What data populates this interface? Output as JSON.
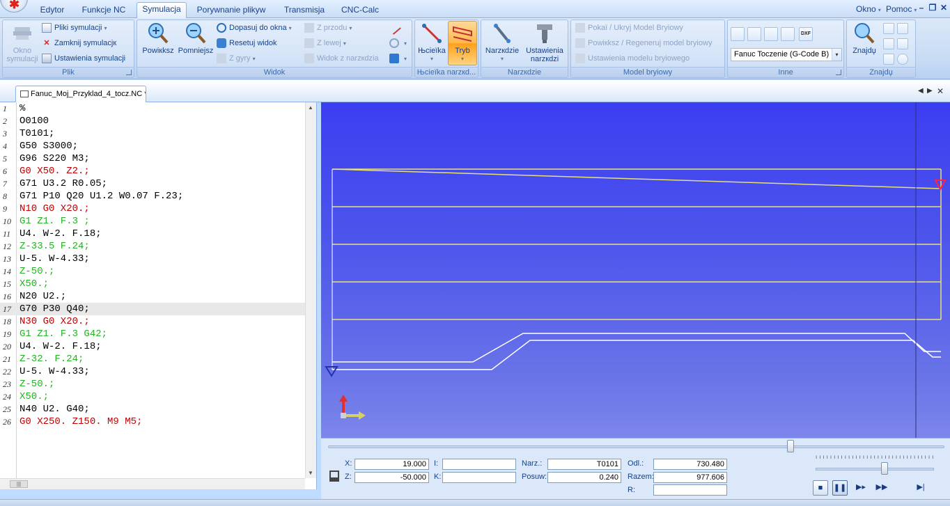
{
  "tabs": [
    {
      "label": "Edytor"
    },
    {
      "label": "Funkcje NC"
    },
    {
      "label": "Symulacja"
    },
    {
      "label": "Porywnanie plikyw"
    },
    {
      "label": "Transmisja"
    },
    {
      "label": "CNC-Calc"
    }
  ],
  "top_right": {
    "okno": "Okno",
    "pomoc": "Pomoc"
  },
  "ribbon": {
    "plik": {
      "label": "Plik",
      "okno_symulacji": "Okno symulacji",
      "pliki_symulacji": "Pliki symulacji",
      "zamknij_symulacje": "Zamknij symulacjк",
      "ustawienia_symulacji": "Ustawienia symulacji"
    },
    "widok": {
      "label": "Widok",
      "powieksz": "Powiкksz",
      "pomniejsz": "Pomniejsz",
      "dopasuj": "Dopasuj do okna",
      "resetuj": "Resetuj widok",
      "z_gory": "Z gуry",
      "z_przodu": "Z przodu",
      "z_lewej": "Z lewej",
      "widok_z_narzedzia": "Widok z narzкdzia"
    },
    "sciezka": {
      "label": "Њcieїka narzкd...",
      "sciezka_btn": "Њcieїka",
      "tryb_btn": "Tryb"
    },
    "narzedzie": {
      "label": "Narzкdzie",
      "narzedzie_btn": "Narzкdzie",
      "ustawienia_narzedzi": "Ustawienia narzкdzi"
    },
    "model": {
      "label": "Model bryіowy",
      "pokaz_ukryj": "Pokaї / Ukryj Model Bryіowy",
      "powieksz_regeneruj": "Powiкksz / Regeneruj model bryіowy",
      "ustawienia_modelu": "Ustawienia modelu bryіowego"
    },
    "inne": {
      "label": "Inne",
      "machine_select": "Fanuc Toczenie (G-Code B)"
    },
    "znajdz": {
      "label": "Znajdџ",
      "znajdz_btn": "Znajdџ"
    }
  },
  "document_tab": "Fanuc_Moj_Przyklad_4_tocz.NC *",
  "code_lines": [
    {
      "n": "1",
      "text": "%",
      "color": "black"
    },
    {
      "n": "2",
      "text": "O0100",
      "color": "black"
    },
    {
      "n": "3",
      "text": "T0101;",
      "color": "black"
    },
    {
      "n": "4",
      "text": "G50 S3000;",
      "color": "black"
    },
    {
      "n": "5",
      "text": "G96 S220 M3;",
      "color": "black"
    },
    {
      "n": "6",
      "text": "G0 X50. Z2.;",
      "color": "red"
    },
    {
      "n": "7",
      "text": "G71 U3.2 R0.05;",
      "color": "black"
    },
    {
      "n": "8",
      "text": "G71 P10 Q20 U1.2 W0.07 F.23;",
      "color": "black"
    },
    {
      "n": "9",
      "text": "N10 G0 X20.;",
      "color": "red"
    },
    {
      "n": "10",
      "text": "G1 Z1. F.3 ;",
      "color": "green"
    },
    {
      "n": "11",
      "text": "U4. W-2. F.18;",
      "color": "black"
    },
    {
      "n": "12",
      "text": "Z-33.5 F.24;",
      "color": "green"
    },
    {
      "n": "13",
      "text": "U-5. W-4.33;",
      "color": "black"
    },
    {
      "n": "14",
      "text": "Z-50.;",
      "color": "green"
    },
    {
      "n": "15",
      "text": "X50.;",
      "color": "green"
    },
    {
      "n": "16",
      "text": "N20 U2.;",
      "color": "black"
    },
    {
      "n": "17",
      "text": "G70 P30 Q40;",
      "color": "black"
    },
    {
      "n": "18",
      "text": "N30 G0 X20.;",
      "color": "red"
    },
    {
      "n": "19",
      "text": "G1 Z1. F.3 G42;",
      "color": "green"
    },
    {
      "n": "20",
      "text": "U4. W-2. F.18;",
      "color": "black"
    },
    {
      "n": "21",
      "text": "Z-32. F.24;",
      "color": "green"
    },
    {
      "n": "22",
      "text": "U-5. W-4.33;",
      "color": "black"
    },
    {
      "n": "23",
      "text": "Z-50.;",
      "color": "green"
    },
    {
      "n": "24",
      "text": "X50.;",
      "color": "green"
    },
    {
      "n": "25",
      "text": "N40 U2. G40;",
      "color": "black"
    },
    {
      "n": "26",
      "text": "G0 X250. Z150. M9 M5;",
      "color": "red"
    }
  ],
  "current_line": 17,
  "readout": {
    "x_label": "X:",
    "x_value": "19.000",
    "z_label": "Z:",
    "z_value": "-50.000",
    "i_label": "I:",
    "i_value": "",
    "k_label": "K:",
    "k_value": "",
    "narz_label": "Narz.:",
    "narz_value": "T0101",
    "posuw_label": "Posuw:",
    "posuw_value": "0.240",
    "odl_label": "Odl.:",
    "odl_value": "730.480",
    "razem_label": "Razem:",
    "razem_value": "977.606",
    "r_label": "R:",
    "r_value": ""
  },
  "playback_position": 0.75,
  "speed_position": 0.58,
  "colors": {
    "code_red": "#c00000",
    "code_green": "#22b522",
    "path_yellow": "#e8e07a",
    "profile_white": "#ffffff",
    "marker_red": "#ff2244",
    "viewport_blue": "#4c54ec"
  }
}
